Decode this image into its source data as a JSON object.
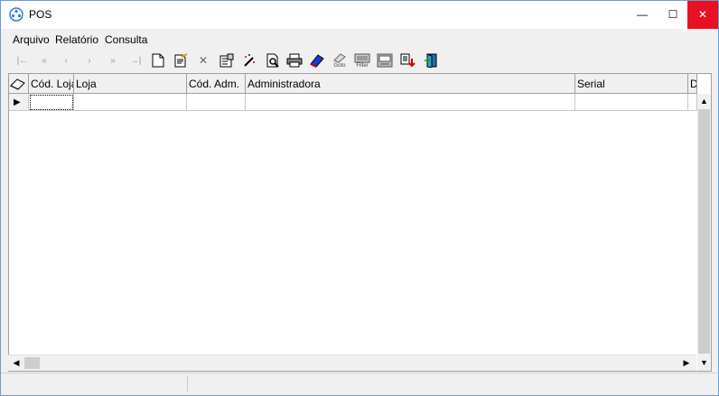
{
  "window": {
    "title": "POS"
  },
  "titlebar_buttons": {
    "minimize": "—",
    "maximize": "☐",
    "close": "✕"
  },
  "menu": [
    {
      "label": "Arquivo"
    },
    {
      "label": "Relatório"
    },
    {
      "label": "Consulta"
    }
  ],
  "toolbar": {
    "buttons": [
      {
        "icon": "first-record-icon",
        "glyph": "|←"
      },
      {
        "icon": "prev-page-icon",
        "glyph": "«"
      },
      {
        "icon": "prev-record-icon",
        "glyph": "‹"
      },
      {
        "icon": "next-record-icon",
        "glyph": "›"
      },
      {
        "icon": "next-page-icon",
        "glyph": "»"
      },
      {
        "icon": "last-record-icon",
        "glyph": "→|"
      },
      {
        "icon": "new-document-icon",
        "glyph": "🗋"
      },
      {
        "icon": "edit-document-icon",
        "glyph": "✎"
      },
      {
        "icon": "delete-icon",
        "glyph": "✕"
      },
      {
        "icon": "properties-icon",
        "glyph": "☷"
      },
      {
        "icon": "wand-icon",
        "glyph": "✧"
      },
      {
        "icon": "print-preview-icon",
        "glyph": "🔍"
      },
      {
        "icon": "print-icon",
        "glyph": "⎙"
      },
      {
        "icon": "book-icon",
        "glyph": "📘"
      },
      {
        "icon": "goto-icon",
        "glyph": "Goto"
      },
      {
        "icon": "filter-icon",
        "glyph": "Filter"
      },
      {
        "icon": "report-icon",
        "glyph": "▤"
      },
      {
        "icon": "export-icon",
        "glyph": "⇩"
      },
      {
        "icon": "exit-door-icon",
        "glyph": "⇥"
      }
    ]
  },
  "grid": {
    "columns": [
      {
        "label": "Cód. Loja"
      },
      {
        "label": "Loja"
      },
      {
        "label": "Cód. Adm."
      },
      {
        "label": "Administradora"
      },
      {
        "label": "Serial"
      },
      {
        "label": "D"
      }
    ],
    "row_indicator": "▶"
  },
  "colors": {
    "accent": "#0078d7",
    "close": "#e81123"
  }
}
